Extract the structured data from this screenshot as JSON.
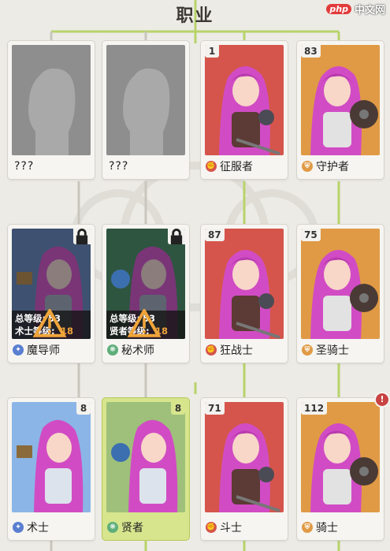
{
  "screen": {
    "title": "职业",
    "watermark": {
      "logo": "php",
      "text": "中文网"
    }
  },
  "colors": {
    "red": "#d5554c",
    "orange": "#e09a45",
    "blue_dark": "#3e5170",
    "green_dark": "#2e5540",
    "blue_light": "#8bb5e6",
    "green_light": "#9ec07a",
    "gray": "#9b9b9b",
    "selected": "#d7e58d"
  },
  "classes": [
    {
      "name": "???",
      "level": "",
      "locked": false,
      "unknown": true,
      "icon": ""
    },
    {
      "name": "???",
      "level": "",
      "locked": false,
      "unknown": true,
      "icon": ""
    },
    {
      "name": "征服者",
      "level": "1",
      "locked": false,
      "unknown": false,
      "icon": "fist-icon"
    },
    {
      "name": "守护者",
      "level": "83",
      "locked": false,
      "unknown": false,
      "icon": "shield-icon"
    },
    {
      "name": "魔导师",
      "level": "",
      "locked": true,
      "unknown": false,
      "icon": "magic-icon",
      "req": [
        {
          "label": "总等级:",
          "value": "53"
        },
        {
          "label": "术士等级:",
          "value": "18"
        }
      ]
    },
    {
      "name": "秘术师",
      "level": "",
      "locked": true,
      "unknown": false,
      "icon": "arcane-icon",
      "req": [
        {
          "label": "总等级:",
          "value": "53"
        },
        {
          "label": "贤者等级:",
          "value": "18"
        }
      ]
    },
    {
      "name": "狂战士",
      "level": "87",
      "locked": false,
      "unknown": false,
      "icon": "fist-icon"
    },
    {
      "name": "圣骑士",
      "level": "75",
      "locked": false,
      "unknown": false,
      "icon": "shield-icon"
    },
    {
      "name": "术士",
      "level": "8",
      "locked": false,
      "unknown": false,
      "icon": "magic-icon"
    },
    {
      "name": "贤者",
      "level": "8",
      "locked": false,
      "unknown": false,
      "icon": "arcane-icon",
      "selected": true
    },
    {
      "name": "斗士",
      "level": "71",
      "locked": false,
      "unknown": false,
      "icon": "fist-icon"
    },
    {
      "name": "骑士",
      "level": "112",
      "locked": false,
      "unknown": false,
      "icon": "shield-icon",
      "alert": "!"
    }
  ]
}
